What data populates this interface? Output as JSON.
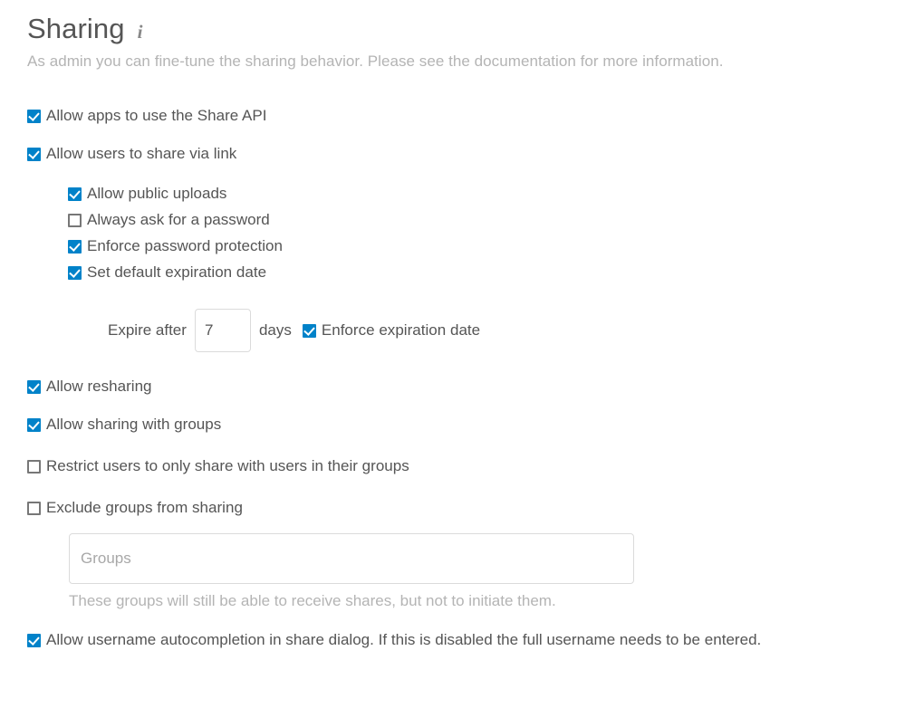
{
  "header": {
    "title": "Sharing",
    "info_icon": "info-icon",
    "subtitle": "As admin you can fine-tune the sharing behavior. Please see the documentation for more information."
  },
  "options": {
    "share_api": {
      "label": "Allow apps to use the Share API",
      "checked": true
    },
    "share_via_link": {
      "label": "Allow users to share via link",
      "checked": true
    },
    "public_uploads": {
      "label": "Allow public uploads",
      "checked": true
    },
    "always_ask_password": {
      "label": "Always ask for a password",
      "checked": false
    },
    "enforce_password": {
      "label": "Enforce password protection",
      "checked": true
    },
    "default_expiration": {
      "label": "Set default expiration date",
      "checked": true
    },
    "enforce_expiration": {
      "label": "Enforce expiration date",
      "checked": true
    },
    "resharing": {
      "label": "Allow resharing",
      "checked": true
    },
    "share_with_groups": {
      "label": "Allow sharing with groups",
      "checked": true
    },
    "restrict_to_own_groups": {
      "label": "Restrict users to only share with users in their groups",
      "checked": false
    },
    "exclude_groups": {
      "label": "Exclude groups from sharing",
      "checked": false
    },
    "username_autocomplete": {
      "label": "Allow username autocompletion in share dialog. If this is disabled the full username needs to be entered.",
      "checked": true
    }
  },
  "expiration": {
    "prefix_label": "Expire after",
    "days_value": "7",
    "days_placeholder": "",
    "suffix_label": "days"
  },
  "groups_field": {
    "placeholder": "Groups",
    "value": "",
    "hint": "These groups will still be able to receive shares, but not to initiate them."
  },
  "colors": {
    "accent": "#0082c9",
    "text": "#555555",
    "muted": "#b4b4b4",
    "border": "#dbdbdb"
  }
}
